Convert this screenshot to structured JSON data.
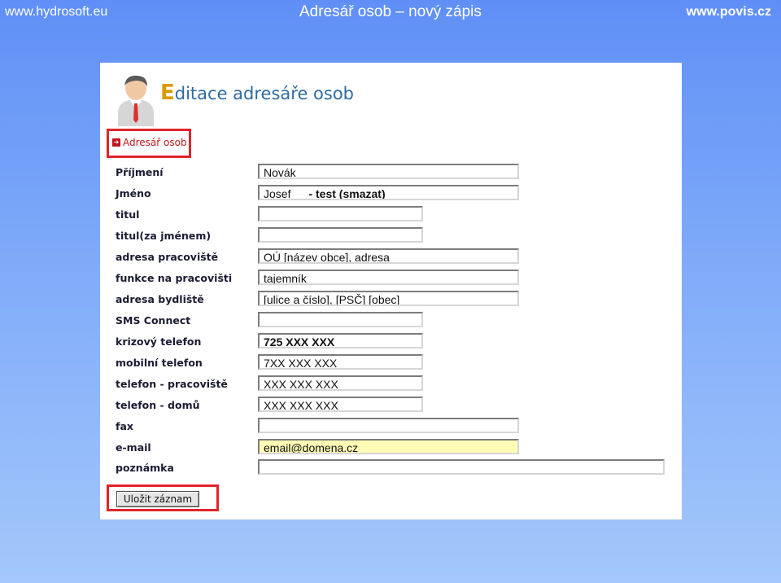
{
  "header": {
    "site_left": "www.hydrosoft.eu",
    "title": "Adresář osob – nový zápis",
    "site_right": "www.povis.cz"
  },
  "panel": {
    "heading_first_letter": "E",
    "heading_rest": "ditace adresáře osob",
    "nav_link": "Adresář osob"
  },
  "fields": {
    "prijmeni": {
      "label": "Příjmení",
      "value": "Novák"
    },
    "jmeno": {
      "label": "Jméno",
      "value": "Josef",
      "extra": "- test (smazat)"
    },
    "titul": {
      "label": "titul",
      "value": ""
    },
    "titul_za": {
      "label": "titul(za jménem)",
      "value": ""
    },
    "adresa_pracoviste": {
      "label": "adresa pracoviště",
      "value": "OÚ [název obce], adresa"
    },
    "funkce": {
      "label": "funkce na pracovišti",
      "value": "tajemník"
    },
    "adresa_bydliste": {
      "label": "adresa bydliště",
      "value": "[ulice a číslo], [PSČ] [obec]"
    },
    "sms": {
      "label": "SMS Connect",
      "value": ""
    },
    "krizovy": {
      "label": "krizový telefon",
      "value": "725 XXX XXX"
    },
    "mobilni": {
      "label": "mobilní telefon",
      "value": "7XX XXX XXX"
    },
    "tel_prac": {
      "label": "telefon - pracoviště",
      "value": "XXX XXX XXX"
    },
    "tel_domu": {
      "label": "telefon - domů",
      "value": "XXX XXX XXX"
    },
    "fax": {
      "label": "fax",
      "value": ""
    },
    "email": {
      "label": "e-mail",
      "value": "email@domena.cz"
    },
    "poznamka": {
      "label": "poznámka",
      "value": ""
    }
  },
  "buttons": {
    "save": "Uložit záznam"
  },
  "colors": {
    "highlight_box": "#e0242a",
    "email_field_bg": "#fffcb5",
    "heading": "#2e6aa6"
  }
}
